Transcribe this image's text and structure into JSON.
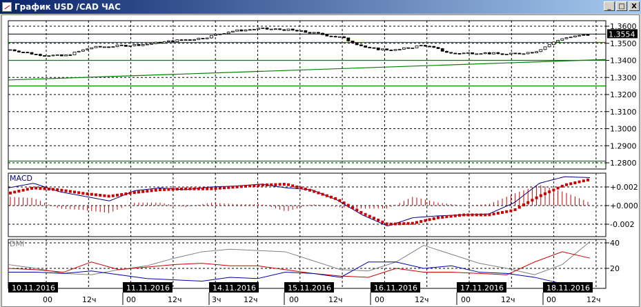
{
  "window": {
    "title": "График USD /CAD  ЧАС",
    "buttons": {
      "minimize": "_",
      "maximize": "□",
      "close": "X"
    }
  },
  "chart_data": [
    {
      "type": "candlestick",
      "name": "price",
      "ylim": [
        1.275,
        1.362
      ],
      "y_ticks": [
        "1.3600",
        "1.3500",
        "1.3400",
        "1.3300",
        "1.3200",
        "1.3100",
        "1.3000",
        "1.2900",
        "1.2800"
      ],
      "current_price": "1.3554",
      "closes": [
        1.3465,
        1.3435,
        1.3425,
        1.3475,
        1.3485,
        1.3495,
        1.3515,
        1.353,
        1.357,
        1.3585,
        1.358,
        1.356,
        1.3535,
        1.347,
        1.346,
        1.349,
        1.344,
        1.3445,
        1.3435,
        1.345,
        1.353,
        1.3552
      ],
      "horizontal_levels": [
        1.3505,
        1.34,
        1.325,
        1.281
      ],
      "trendline": [
        1.3285,
        1.3405
      ],
      "colors": {
        "candle": "#000000",
        "levels": "#008000",
        "grid": "#000000"
      }
    },
    {
      "type": "line",
      "name": "MACD",
      "label": "MACD",
      "ylim": [
        -0.003,
        0.0035
      ],
      "y_ticks": [
        "+0.002",
        "+0.000",
        "-0.002"
      ],
      "macd": [
        0.0019,
        0.0024,
        0.0015,
        0.001,
        0.0005,
        0.0016,
        0.0019,
        0.0017,
        0.002,
        0.0021,
        0.0023,
        0.0019,
        0.0017,
        0.0006,
        -0.001,
        -0.0022,
        -0.0013,
        -0.0011,
        -0.001,
        -0.0009,
        0.0003,
        0.0024,
        0.0031,
        0.003
      ],
      "signal": [
        0.0013,
        0.0019,
        0.0017,
        0.0013,
        0.001,
        0.0014,
        0.0017,
        0.0018,
        0.0018,
        0.002,
        0.0022,
        0.0023,
        0.0016,
        0.0007,
        -0.0008,
        -0.002,
        -0.0019,
        -0.0013,
        -0.001,
        -0.001,
        -0.0005,
        0.001,
        0.0022,
        0.0028
      ],
      "colors": {
        "macd": "#000080",
        "signal": "#cc0000",
        "histogram": "#cc0000"
      }
    },
    {
      "type": "line",
      "name": "DMI",
      "label": "DMI",
      "ylim": [
        0,
        45
      ],
      "y_ticks": [
        "40",
        "20"
      ],
      "adx": [
        23,
        20,
        16,
        15,
        19,
        22,
        28,
        33,
        35,
        34,
        33,
        26,
        19,
        18,
        25,
        38,
        31,
        24,
        20,
        15,
        23,
        41
      ],
      "plus_di": [
        20,
        19,
        17,
        25,
        19,
        21,
        23,
        24,
        22,
        22,
        19,
        16,
        14,
        13,
        20,
        17,
        17,
        16,
        15,
        25,
        33,
        28
      ],
      "minus_di": [
        17,
        17,
        16,
        18,
        15,
        12,
        11,
        10,
        13,
        12,
        17,
        16,
        13,
        25,
        25,
        20,
        22,
        17,
        16,
        13,
        8
      ],
      "colors": {
        "adx": "#808080",
        "plus_di": "#cc0000",
        "minus_di": "#0000aa"
      }
    }
  ],
  "time_axis": {
    "dates": [
      "10.11.2016",
      "11.11.2016",
      "14.11.2016",
      "15.11.2016",
      "16.11.2016",
      "17.11.2016",
      "18.11.2016"
    ],
    "hours": [
      [
        "00",
        "12ч"
      ],
      [
        "00",
        "12ч"
      ],
      [
        "3ч",
        "12ч"
      ],
      [
        "00",
        "12ч"
      ],
      [
        "00",
        "12ч"
      ],
      [
        "00",
        "12ч"
      ],
      [
        "00",
        "12ч"
      ]
    ]
  }
}
